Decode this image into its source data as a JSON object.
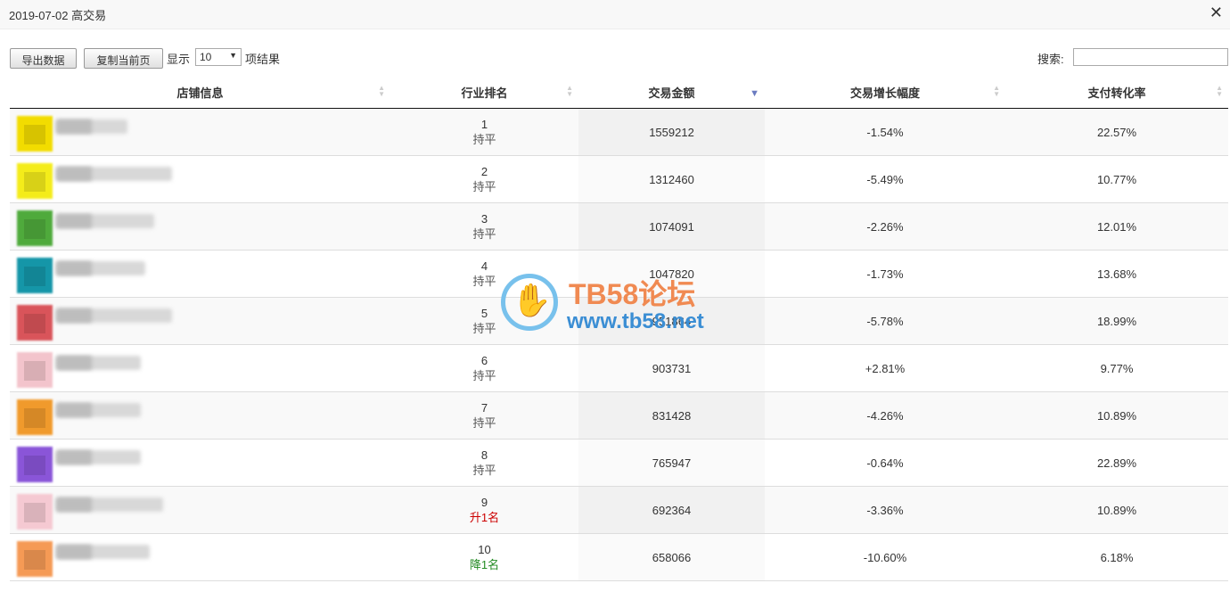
{
  "dialog": {
    "title": "2019-07-02 高交易",
    "close_symbol": "✕"
  },
  "toolbar": {
    "export_label": "导出数据",
    "copy_label": "复制当前页",
    "show_label": "显示",
    "page_size": "10",
    "result_label": "项结果",
    "search_label": "搜索:",
    "search_value": ""
  },
  "table": {
    "columns": [
      "店铺信息",
      "行业排名",
      "交易金额",
      "交易增长幅度",
      "支付转化率"
    ],
    "sorted_column": "交易金额",
    "rows": [
      {
        "rank": "1",
        "change": "持平",
        "change_type": "flat",
        "amount": "1559212",
        "growth": "-1.54%",
        "conversion": "22.57%",
        "logo_color": "#f2dc00"
      },
      {
        "rank": "2",
        "change": "持平",
        "change_type": "flat",
        "amount": "1312460",
        "growth": "-5.49%",
        "conversion": "10.77%",
        "logo_color": "#f4ec1a"
      },
      {
        "rank": "3",
        "change": "持平",
        "change_type": "flat",
        "amount": "1074091",
        "growth": "-2.26%",
        "conversion": "12.01%",
        "logo_color": "#4faa3c"
      },
      {
        "rank": "4",
        "change": "持平",
        "change_type": "flat",
        "amount": "1047820",
        "growth": "-1.73%",
        "conversion": "13.68%",
        "logo_color": "#1596a8"
      },
      {
        "rank": "5",
        "change": "持平",
        "change_type": "flat",
        "amount": "951864",
        "growth": "-5.78%",
        "conversion": "18.99%",
        "logo_color": "#d9545a"
      },
      {
        "rank": "6",
        "change": "持平",
        "change_type": "flat",
        "amount": "903731",
        "growth": "+2.81%",
        "conversion": "9.77%",
        "logo_color": "#f3c4cc"
      },
      {
        "rank": "7",
        "change": "持平",
        "change_type": "flat",
        "amount": "831428",
        "growth": "-4.26%",
        "conversion": "10.89%",
        "logo_color": "#f09a2c"
      },
      {
        "rank": "8",
        "change": "持平",
        "change_type": "flat",
        "amount": "765947",
        "growth": "-0.64%",
        "conversion": "22.89%",
        "logo_color": "#8a55d8"
      },
      {
        "rank": "9",
        "change": "升1名",
        "change_type": "up",
        "amount": "692364",
        "growth": "-3.36%",
        "conversion": "10.89%",
        "logo_color": "#f5c9d2"
      },
      {
        "rank": "10",
        "change": "降1名",
        "change_type": "down",
        "amount": "658066",
        "growth": "-10.60%",
        "conversion": "6.18%",
        "logo_color": "#f59a55"
      }
    ]
  },
  "watermark": {
    "line1": "TB58论坛",
    "line2": "www.tb58.net"
  }
}
